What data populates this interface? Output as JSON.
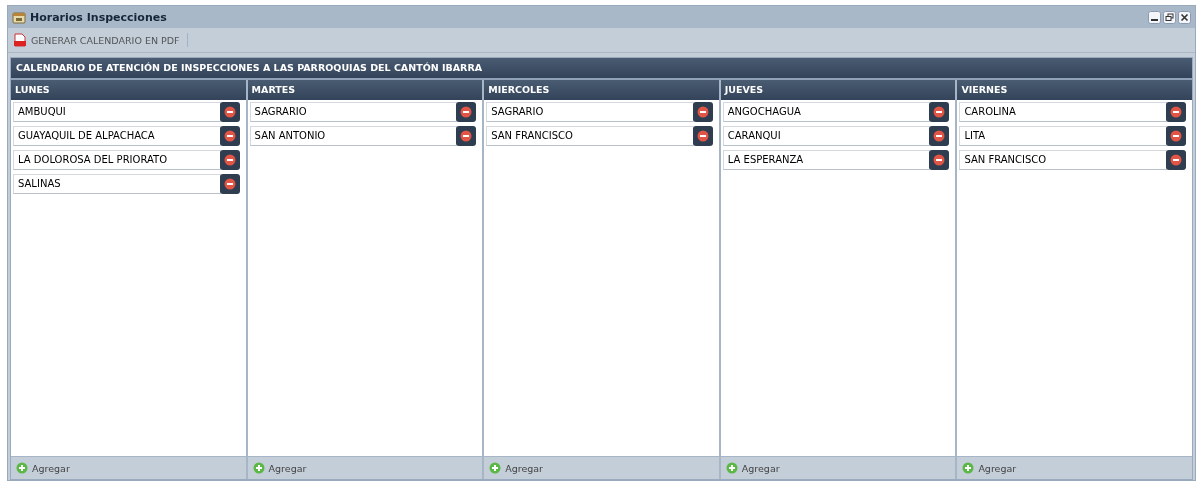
{
  "window": {
    "title": "Horarios Inspecciones"
  },
  "toolbar": {
    "buttons": [
      "GENERAR CALENDARIO EN PDF"
    ]
  },
  "panel": {
    "title": "CALENDARIO DE ATENCIÓN DE INSPECCIONES A LAS PARROQUIAS DEL CANTÓN IBARRA"
  },
  "columns": [
    {
      "title": "LUNES",
      "items": [
        "AMBUQUI",
        "GUAYAQUIL DE ALPACHACA",
        "LA DOLOROSA DEL PRIORATO",
        "SALINAS"
      ],
      "footer": "Agregar"
    },
    {
      "title": "MARTES",
      "items": [
        "SAGRARIO",
        "SAN ANTONIO"
      ],
      "footer": "Agregar"
    },
    {
      "title": "MIERCOLES",
      "items": [
        "SAGRARIO",
        "SAN FRANCISCO"
      ],
      "footer": "Agregar"
    },
    {
      "title": "JUEVES",
      "items": [
        "ANGOCHAGUA",
        "CARANQUI",
        "LA ESPERANZA"
      ],
      "footer": "Agregar"
    },
    {
      "title": "VIERNES",
      "items": [
        "CAROLINA",
        "LITA",
        "SAN FRANCISCO"
      ],
      "footer": "Agregar"
    }
  ]
}
